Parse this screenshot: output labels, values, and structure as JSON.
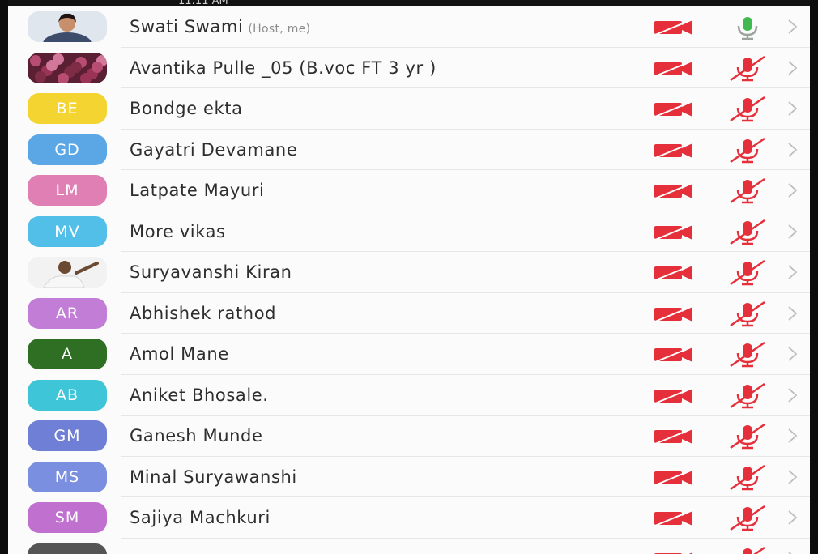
{
  "status_bar": {
    "time_partial": "11:11 AM"
  },
  "participants": [
    {
      "name": "Swati Swami",
      "tag": "(Host, me)",
      "avatar_type": "photo",
      "avatar_photo": "woman-portrait",
      "initials": "",
      "avatar_color": "#dfe6ee",
      "video": "off",
      "mic": "on"
    },
    {
      "name": "Avantika Pulle _05 (B.voc FT 3 yr )",
      "tag": "",
      "avatar_type": "photo",
      "avatar_photo": "flowers",
      "initials": "",
      "avatar_color": "#7a2e45",
      "video": "off",
      "mic": "muted"
    },
    {
      "name": "Bondge ekta",
      "tag": "",
      "avatar_type": "initials",
      "initials": "BE",
      "avatar_color": "#f4d431",
      "video": "off",
      "mic": "muted"
    },
    {
      "name": "Gayatri Devamane",
      "tag": "",
      "avatar_type": "initials",
      "initials": "GD",
      "avatar_color": "#5ba7e6",
      "video": "off",
      "mic": "muted"
    },
    {
      "name": "Latpate Mayuri",
      "tag": "",
      "avatar_type": "initials",
      "initials": "LM",
      "avatar_color": "#e07fb4",
      "video": "off",
      "mic": "muted"
    },
    {
      "name": "More vikas",
      "tag": "",
      "avatar_type": "initials",
      "initials": "MV",
      "avatar_color": "#52bfe8",
      "video": "off",
      "mic": "muted"
    },
    {
      "name": "Suryavanshi Kiran",
      "tag": "",
      "avatar_type": "photo",
      "avatar_photo": "man-portrait",
      "initials": "",
      "avatar_color": "#ececec",
      "video": "off",
      "mic": "muted"
    },
    {
      "name": "Abhishek rathod",
      "tag": "",
      "avatar_type": "initials",
      "initials": "AR",
      "avatar_color": "#c27dd6",
      "video": "off",
      "mic": "muted"
    },
    {
      "name": "Amol Mane",
      "tag": "",
      "avatar_type": "initials",
      "initials": "A",
      "avatar_color": "#2f6f24",
      "video": "off",
      "mic": "muted"
    },
    {
      "name": "Aniket Bhosale.",
      "tag": "",
      "avatar_type": "initials",
      "initials": "AB",
      "avatar_color": "#3fc5d8",
      "video": "off",
      "mic": "muted"
    },
    {
      "name": "Ganesh Munde",
      "tag": "",
      "avatar_type": "initials",
      "initials": "GM",
      "avatar_color": "#6f7fd6",
      "video": "off",
      "mic": "muted"
    },
    {
      "name": "Minal Suryawanshi",
      "tag": "",
      "avatar_type": "initials",
      "initials": "MS",
      "avatar_color": "#7b8fe0",
      "video": "off",
      "mic": "muted"
    },
    {
      "name": "Sajiya Machkuri",
      "tag": "",
      "avatar_type": "initials",
      "initials": "SM",
      "avatar_color": "#c071cf",
      "video": "off",
      "mic": "muted"
    },
    {
      "name": "",
      "tag": "",
      "avatar_type": "photo",
      "avatar_photo": "partial",
      "initials": "",
      "avatar_color": "#555555",
      "video": "off",
      "mic": "muted"
    }
  ],
  "colors": {
    "muted_red": "#e5303b",
    "mic_on_green": "#3fb950",
    "chevron": "#bdbdbd",
    "name_text": "#2e2e2e",
    "tag_text": "#8c8c8c"
  },
  "icons": {
    "video": "video-off-icon",
    "mic_muted": "mic-muted-icon",
    "mic_on": "mic-on-icon",
    "row_action": "chevron-right-icon"
  }
}
